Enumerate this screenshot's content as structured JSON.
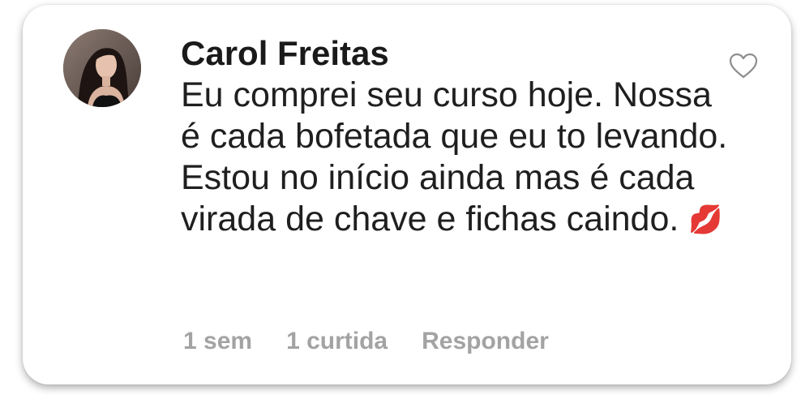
{
  "comment": {
    "author": "Carol Freitas",
    "text": "Eu comprei seu curso hoje. Nossa é cada bofetada que eu to levando. Estou no início ainda mas é cada virada de chave e fichas caindo.",
    "emoji": "💋",
    "avatar_icon": "profile-photo",
    "like_icon": "heart-outline-icon"
  },
  "meta": {
    "time": "1 sem",
    "likes": "1 curtida",
    "reply_label": "Responder"
  },
  "colors": {
    "text": "#1a1a1a",
    "meta": "#a3a3a3",
    "icon": "#8e8e8e"
  }
}
